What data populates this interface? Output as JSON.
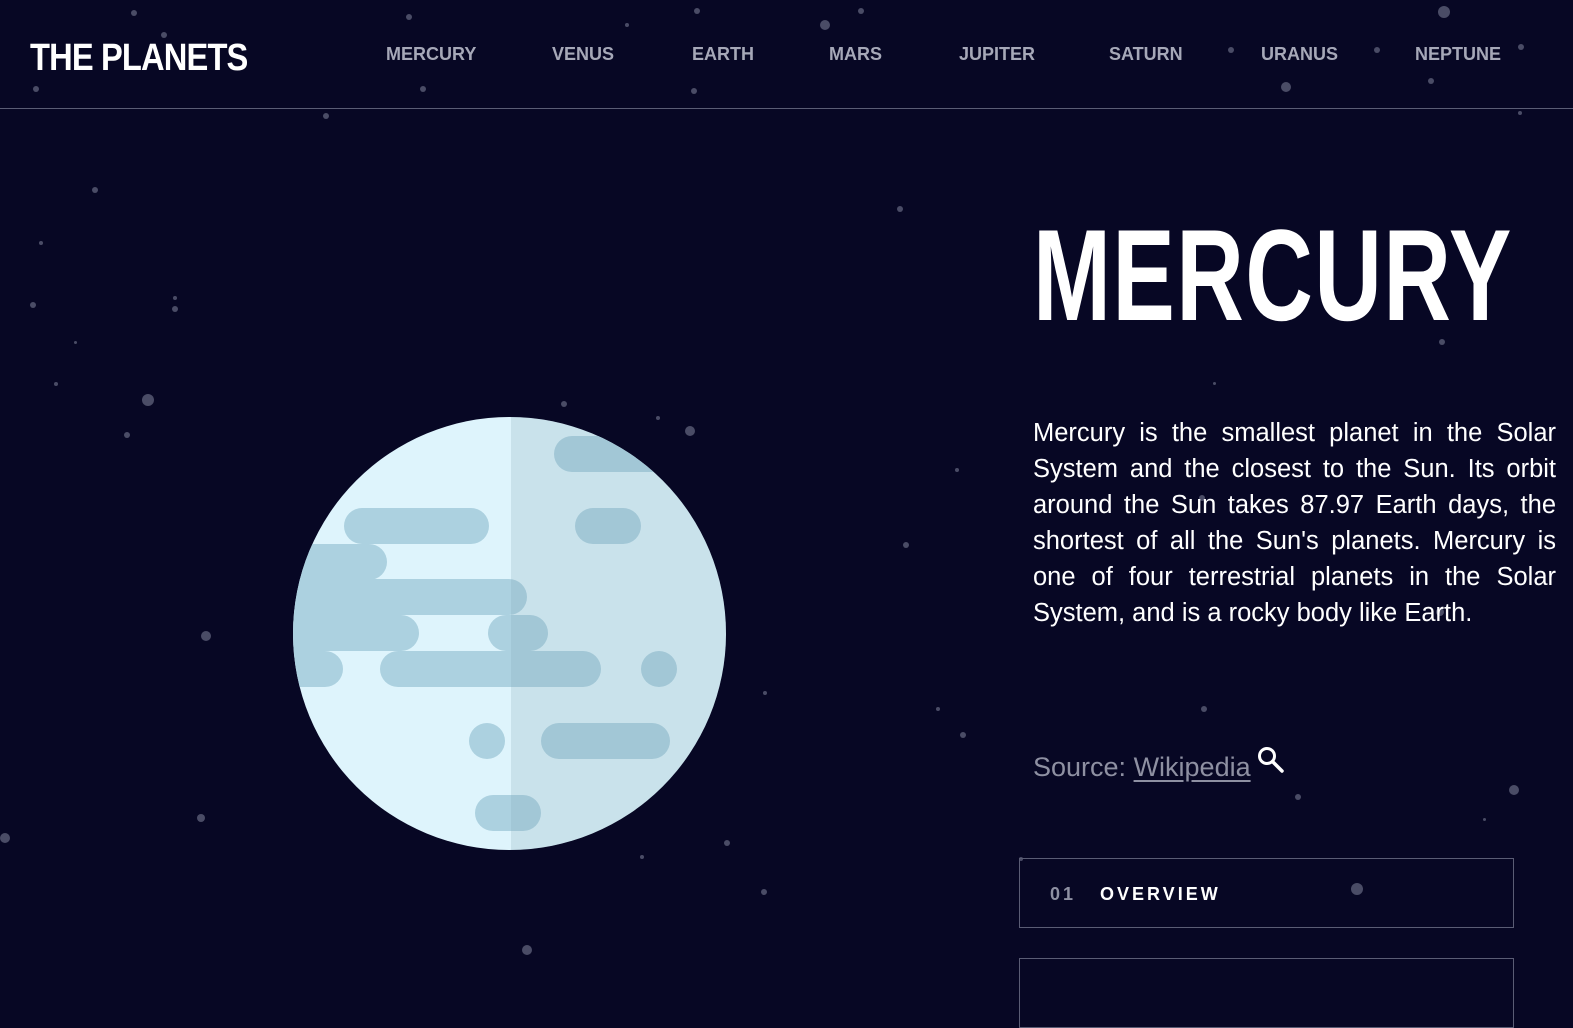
{
  "header": {
    "logo": "THE PLANETS",
    "nav": [
      "MERCURY",
      "VENUS",
      "EARTH",
      "MARS",
      "JUPITER",
      "SATURN",
      "URANUS",
      "NEPTUNE"
    ]
  },
  "planet": {
    "name": "MERCURY",
    "description": "Mercury is the smallest planet in the Solar System and the closest to the Sun. Its orbit around the Sun takes 87.97 Earth days, the shortest of all the Sun's planets. Mercury is one of four terrestrial planets in the Solar System, and is a rocky body like Earth.",
    "source_prefix": "Source: ",
    "source_link": "Wikipedia",
    "source_icon": "search-icon"
  },
  "tabs": [
    {
      "number": "01",
      "label": "OVERVIEW"
    }
  ],
  "colors": {
    "background": "#070724",
    "text": "#ffffff",
    "muted": "#8e90a2",
    "border": "#5a5c74",
    "planet_light": "#def4fc",
    "planet_shade": "#c8dfe6",
    "planet_crater": "#acd1e0"
  }
}
